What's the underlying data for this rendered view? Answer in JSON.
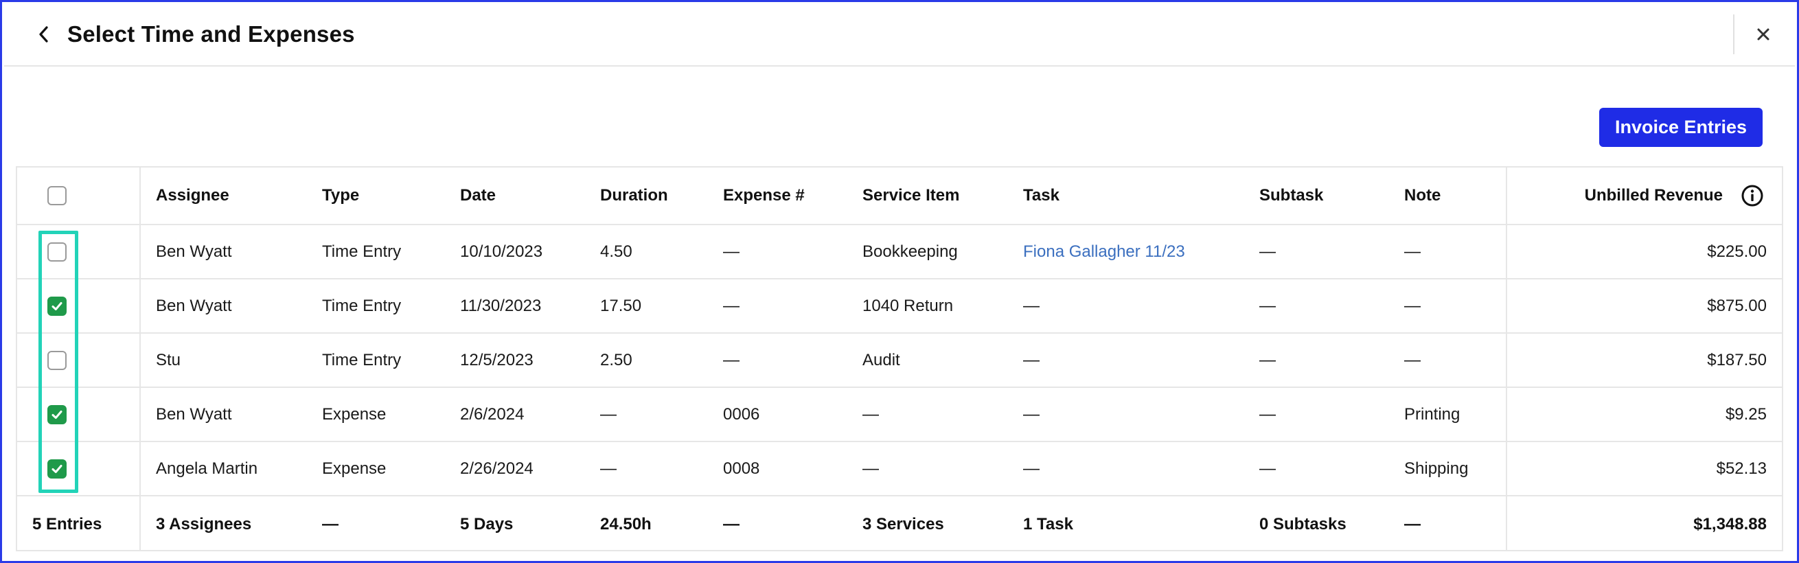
{
  "header": {
    "title": "Select Time and Expenses"
  },
  "toolbar": {
    "invoice_label": "Invoice Entries"
  },
  "table": {
    "columns": {
      "assignee": "Assignee",
      "type": "Type",
      "date": "Date",
      "duration": "Duration",
      "expense": "Expense #",
      "service": "Service Item",
      "task": "Task",
      "subtask": "Subtask",
      "note": "Note",
      "revenue": "Unbilled Revenue"
    },
    "rows": [
      {
        "checked": false,
        "assignee": "Ben Wyatt",
        "type": "Time Entry",
        "date": "10/10/2023",
        "duration": "4.50",
        "expense": "—",
        "service": "Bookkeeping",
        "task": "Fiona Gallagher 11/23",
        "subtask": "—",
        "note": "—",
        "revenue": "$225.00"
      },
      {
        "checked": true,
        "assignee": "Ben Wyatt",
        "type": "Time Entry",
        "date": "11/30/2023",
        "duration": "17.50",
        "expense": "—",
        "service": "1040 Return",
        "task": "—",
        "subtask": "—",
        "note": "—",
        "revenue": "$875.00"
      },
      {
        "checked": false,
        "assignee": "Stu",
        "type": "Time Entry",
        "date": "12/5/2023",
        "duration": "2.50",
        "expense": "—",
        "service": "Audit",
        "task": "—",
        "subtask": "—",
        "note": "—",
        "revenue": "$187.50"
      },
      {
        "checked": true,
        "assignee": "Ben Wyatt",
        "type": "Expense",
        "date": "2/6/2024",
        "duration": "—",
        "expense": "0006",
        "service": "—",
        "task": "—",
        "subtask": "—",
        "note": "Printing",
        "revenue": "$9.25"
      },
      {
        "checked": true,
        "assignee": "Angela Martin",
        "type": "Expense",
        "date": "2/26/2024",
        "duration": "—",
        "expense": "0008",
        "service": "—",
        "task": "—",
        "subtask": "—",
        "note": "Shipping",
        "revenue": "$52.13"
      }
    ],
    "footer": {
      "entries": "5 Entries",
      "assignee": "3 Assignees",
      "type": "—",
      "date": "5 Days",
      "duration": "24.50h",
      "expense": "—",
      "service": "3 Services",
      "task": "1 Task",
      "subtask": "0 Subtasks",
      "note": "—",
      "revenue": "$1,348.88"
    }
  },
  "icons": {
    "back": "chevron-left-icon",
    "close": "close-icon",
    "info": "info-icon",
    "check": "check-icon"
  },
  "colors": {
    "accent": "#1f2ce6",
    "checkbox_checked": "#1f9a4a",
    "link": "#3b6fbf",
    "highlight": "#22d3b8",
    "frame": "#2b3be8"
  }
}
